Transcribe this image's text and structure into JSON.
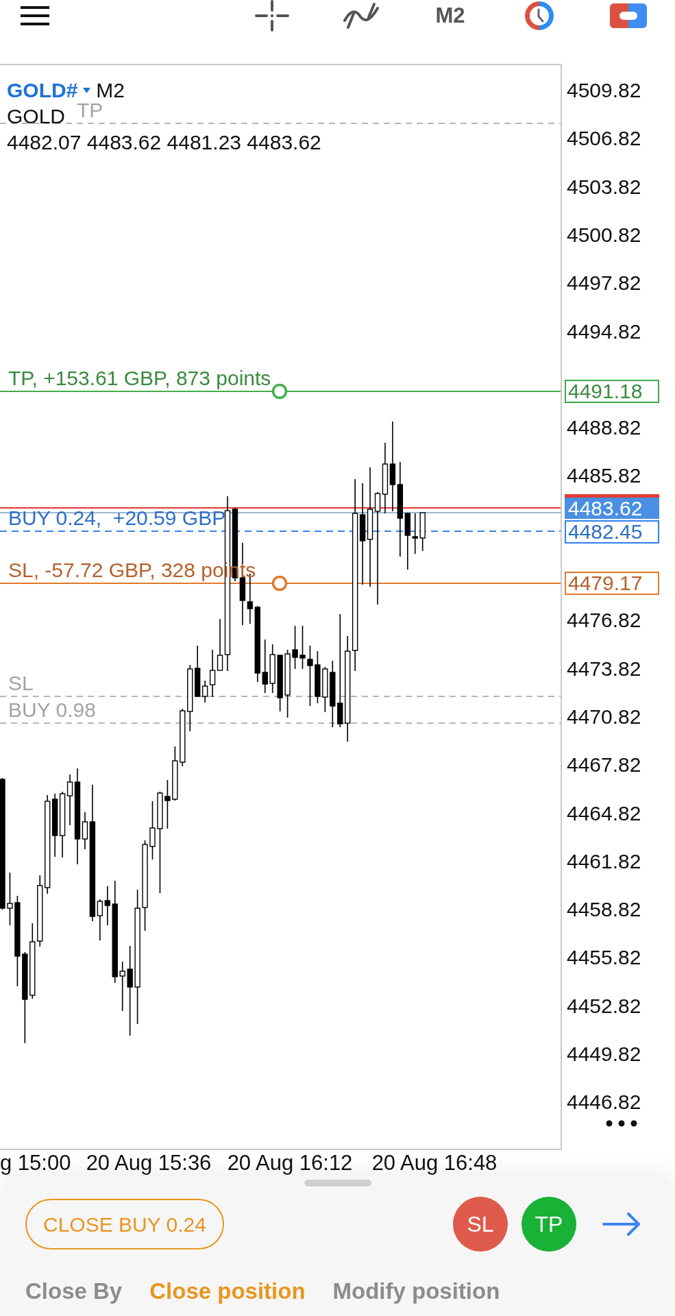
{
  "toolbar": {
    "timeframe": "M2"
  },
  "chart": {
    "symbol": "GOLD#",
    "timeframe": "M2",
    "description": "GOLD",
    "ohlc": "4482.07 4483.62 4481.23 4483.62",
    "lines": [
      {
        "kind": "pending_tp",
        "label": "TP"
      },
      {
        "kind": "tp",
        "label": "TP, +153.61 GBP, 873 points",
        "price": "4491.18"
      },
      {
        "kind": "position",
        "label": "BUY 0.24,  +20.59 GBP",
        "price": "4482.45"
      },
      {
        "kind": "sl",
        "label": "SL, -57.72 GBP, 328 points",
        "price": "4479.17"
      },
      {
        "kind": "pending_sl",
        "label": "SL"
      },
      {
        "kind": "pending_entry",
        "label": "BUY 0.98"
      }
    ],
    "current_price": "4483.62",
    "price_axis": [
      "4509.82",
      "4506.82",
      "4503.82",
      "4500.82",
      "4497.82",
      "4494.82",
      "4488.82",
      "4485.82",
      "4476.82",
      "4473.82",
      "4470.82",
      "4467.82",
      "4464.82",
      "4461.82",
      "4458.82",
      "4455.82",
      "4452.82",
      "4449.82",
      "4446.82"
    ],
    "time_axis": [
      "g 15:00",
      "20 Aug 15:36",
      "20 Aug 16:12",
      "20 Aug 16:48"
    ]
  },
  "order_panel": {
    "close_button": "CLOSE BUY 0.24",
    "sl_button": "SL",
    "tp_button": "TP",
    "tabs": [
      {
        "label": "Close By",
        "selected": false
      },
      {
        "label": "Close position",
        "selected": true
      },
      {
        "label": "Modify position",
        "selected": false
      }
    ]
  }
}
